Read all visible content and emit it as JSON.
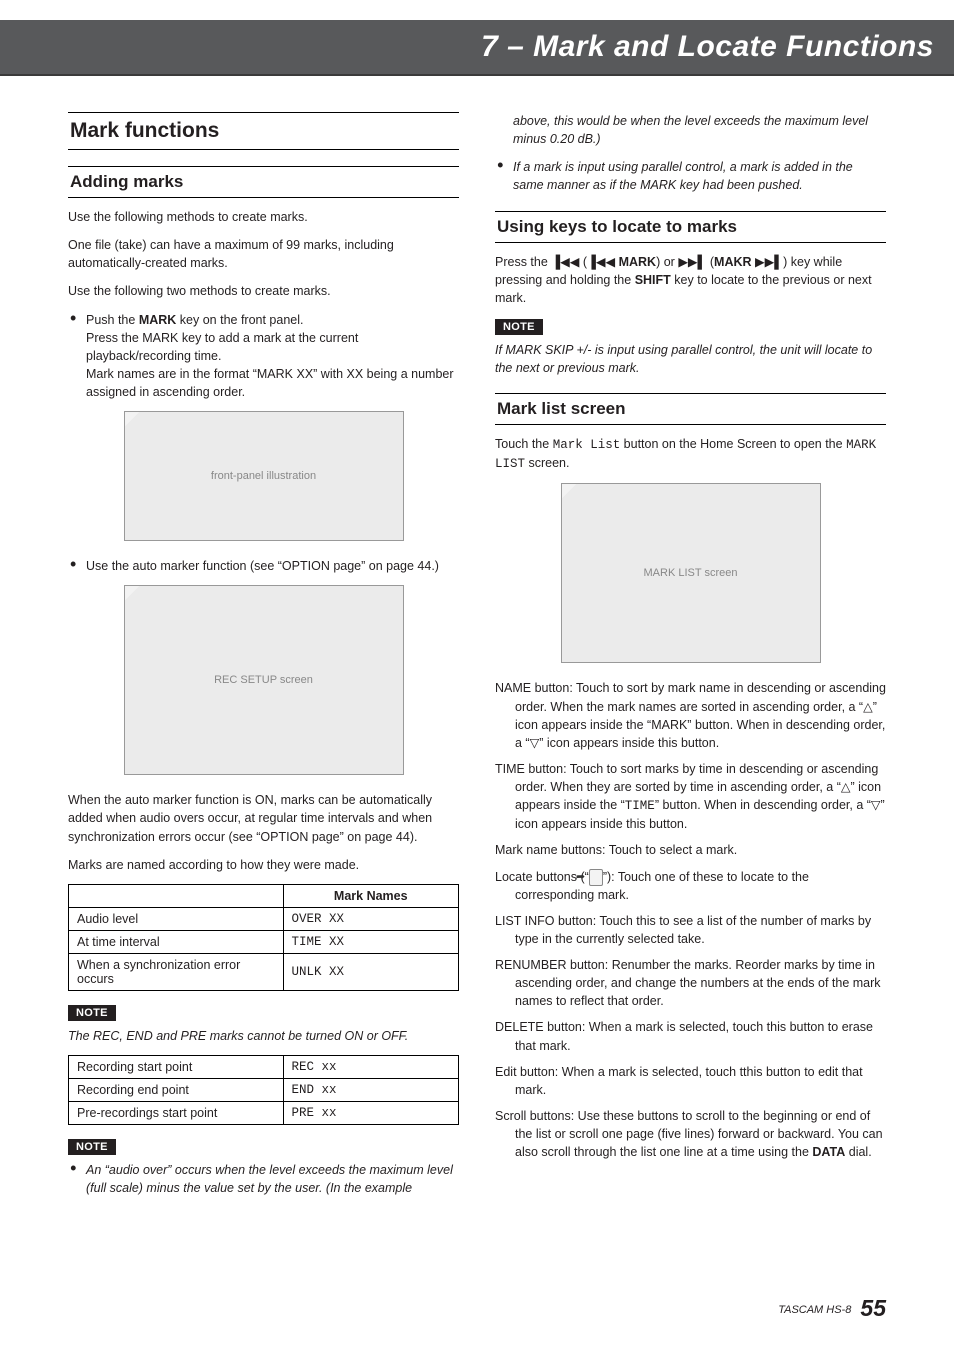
{
  "chapterTitle": "7 – Mark and Locate Functions",
  "left": {
    "h2": "Mark functions",
    "addingMarks": {
      "h3": "Adding marks",
      "p1": "Use the following methods to create marks.",
      "p2": "One file (take) can have a maximum of 99 marks, including automatically-created marks.",
      "p3": "Use the following two methods to create marks.",
      "b1_line1": "Push the ",
      "b1_key": "MARK",
      "b1_line1b": " key on the front panel.",
      "b1_line2": "Press the MARK key to add a mark at the current playback/recording time.",
      "b1_line3": "Mark names are in the format “MARK XX” with XX being a number assigned in ascending order.",
      "img1_label": "front-panel illustration",
      "b2": "Use the auto marker function (see “OPTION page” on page 44.)",
      "img2_label": "REC SETUP screen",
      "p4": "When the auto marker function is ON, marks can be automatically added when audio overs occur, at regular time intervals and when synchronization errors occur (see “OPTION page” on page 44).",
      "p5": "Marks are named according to how they were made.",
      "table1": {
        "headText": "Mark Names",
        "rows": [
          {
            "label": "Audio level",
            "value": "OVER XX"
          },
          {
            "label": "At time interval",
            "value": "TIME XX"
          },
          {
            "label": "When a synchronization error occurs",
            "value": "UNLK XX"
          }
        ]
      },
      "note1_label": "NOTE",
      "note1_text": "The REC, END and PRE marks cannot be turned ON or OFF.",
      "table2": {
        "rows": [
          {
            "label": "Recording start point",
            "value": "REC xx"
          },
          {
            "label": "Recording end point",
            "value": "END xx"
          },
          {
            "label": "Pre-recordings start point",
            "value": "PRE xx"
          }
        ]
      },
      "note2_label": "NOTE",
      "note2_b1": "An “audio over” occurs when the level exceeds the maximum level (full scale) minus the value set by the user. (In the example"
    }
  },
  "right": {
    "cont_top": "above, this would be when the level exceeds the maximum level minus 0.20 dB.)",
    "cont_b2": "If a mark is input using parallel control, a mark is added in the same manner as if the MARK key had been pushed.",
    "usingKeys": {
      "h3": "Using keys to locate to marks",
      "p_a": "Press the ",
      "sym1": "▐◀◀",
      "paren1_a": " (",
      "sym1b": "▐◀◀",
      "paren1_mark": " MARK",
      "paren1_b": ") or ",
      "sym2": "▶▶▌",
      "paren2_a": " (",
      "paren2_makr": "MAKR ",
      "sym2b": "▶▶▌",
      "paren2_b": ") key while pressing and holding the ",
      "shift": "SHIFT",
      "p_d": " key to locate to the previous or next mark.",
      "note_label": "NOTE",
      "note_text": "If MARK SKIP +/- is input using parallel control, the unit will locate to the next or previous mark."
    },
    "markList": {
      "h3": "Mark list screen",
      "p1_a": "Touch the ",
      "p1_m1": "Mark List",
      "p1_b": " button on the Home Screen to open the ",
      "p1_m2": "MARK LIST",
      "p1_c": " screen.",
      "img_label": "MARK LIST screen",
      "defs": {
        "name": "NAME button: Touch to sort by mark name in descending or ascending order. When the mark names are sorted in ascending order, a “△” icon appears inside the “MARK” button. When in descending order, a “▽” icon appears inside this button.",
        "time_a": "TIME button: Touch to sort marks by time in descending or ascending order. When they are sorted by time in ascending order, a “△” icon appears inside the “",
        "time_mono": "TIME",
        "time_b": "” button. When in descending order, a “▽” icon appears inside this button.",
        "markname": "Mark name buttons: Touch to select a mark.",
        "locate_a": "Locate buttons (“",
        "locate_glyph": "➦",
        "locate_b": "”): Touch one of these to locate to the corresponding mark.",
        "listinfo": "LIST INFO button: Touch this to see a list of the number of marks by type in the currently selected take.",
        "renumber": "RENUMBER button: Renumber the marks. Reorder marks by time in ascending order, and change the numbers at the ends of the mark names to reflect that order.",
        "delete": "DELETE button: When a mark is selected, touch this button to erase that mark.",
        "edit": "Edit button: When a mark is selected, touch tthis button to edit that mark.",
        "scroll_a": "Scroll buttons: Use these buttons to scroll to the beginning or end of the list or scroll one page (five lines) forward or backward. You can also scroll through the list one line at a time using the ",
        "scroll_key": "DATA",
        "scroll_b": " dial."
      }
    }
  },
  "footer": {
    "model": "TASCAM  HS-8",
    "page": "55"
  }
}
